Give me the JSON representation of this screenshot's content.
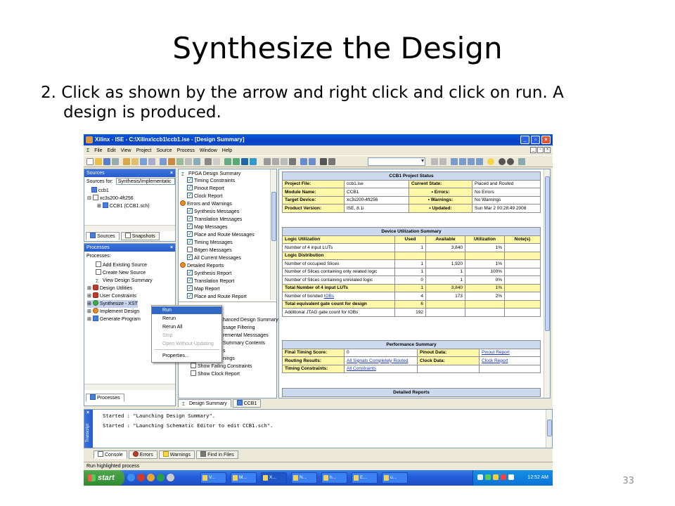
{
  "slide": {
    "title": "Synthesize the Design",
    "body_line1": "2. Click as shown by the arrow and right click and click on run.  A",
    "body_line2": "design is produced.",
    "page_number": "33"
  },
  "window": {
    "title": "Xilinx - ISE - C:\\Xilinx\\ccb1\\ccb1.ise - [Design Summary]",
    "menu": [
      "File",
      "Edit",
      "View",
      "Project",
      "Source",
      "Process",
      "Window",
      "Help"
    ]
  },
  "sources": {
    "header": "Sources",
    "sources_for_label": "Sources for:",
    "sources_for_value": "Synthesis/Implementatic",
    "tree": [
      "ccb1",
      "xc3s200-4ft256",
      "CCB1 (CCB1.sch)"
    ],
    "tabs": [
      "Sources",
      "Snapshots"
    ]
  },
  "processes": {
    "header": "Processes",
    "subheader": "Processes:",
    "items": [
      "Add Existing Source",
      "Create New Source",
      "View Design Summary",
      "Design Utilities",
      "User Constraints",
      "Synthesize - XST",
      "Implement Design",
      "Generate Program"
    ],
    "tab": "Processes"
  },
  "context_menu": {
    "items": [
      "Run",
      "Rerun",
      "Rerun All",
      "Stop",
      "Open Without Updating",
      "Properties..."
    ]
  },
  "summary_tree": {
    "header": "FPGA Design Summary",
    "items": [
      "Timing Constraints",
      "Pinout Report",
      "Clock Report",
      "Errors and Warnings",
      "Synthesis Messages",
      "Translation Messages",
      "Map Messages",
      "Place and Route Messages",
      "Timing Messages",
      "Bitgen Messages",
      "All Current Messages",
      "Detailed Reports",
      "Synthesis Report",
      "Translation Report",
      "Map Report",
      "Place and Route Report"
    ],
    "lower_items": [
      "hanced Design Summary",
      "ssage Filtering",
      "remental Messsages",
      "Summary Contents",
      "s",
      "nings",
      "Show Failing Constraints",
      "Show Clock Report"
    ],
    "tabs": [
      "Design Summary",
      "CCB1"
    ]
  },
  "project_status": {
    "title": "CCB1 Project Status",
    "rows": [
      [
        "Project File:",
        "ccb1.ise",
        "Current State:",
        "Placed and Routed"
      ],
      [
        "Module Name:",
        "CCB1",
        "• Errors:",
        "No Errors"
      ],
      [
        "Target Device:",
        "xc3s200-4ft256",
        "• Warnings:",
        "No Warnings"
      ],
      [
        "Product Version:",
        "ISE, 8.1i",
        "• Updated:",
        "Sun Mar 2 00:28:49 2008"
      ]
    ]
  },
  "utilization": {
    "title": "Device Utilization Summary",
    "columns": [
      "Logic Utilization",
      "Used",
      "Available",
      "Utilization",
      "Note(s)"
    ],
    "rows": [
      [
        "Number of 4 input LUTs",
        "1",
        "3,840",
        "1%",
        ""
      ],
      [
        "Logic Distribution",
        "",
        "",
        "",
        ""
      ],
      [
        "Number of occupied Slices",
        "1",
        "1,920",
        "1%",
        ""
      ],
      [
        "Number of Slices containing only related logic",
        "1",
        "1",
        "100%",
        ""
      ],
      [
        "Number of Slices containing unrelated logic",
        "0",
        "1",
        "0%",
        ""
      ],
      [
        "Total Number of 4 input LUTs",
        "1",
        "3,840",
        "1%",
        ""
      ],
      [
        "Number of bonded IOBs",
        "4",
        "173",
        "2%",
        ""
      ],
      [
        "Total equivalent gate count for design",
        "6",
        "",
        "",
        ""
      ],
      [
        "Additional JTAG gate count for IOBs",
        "192",
        "",
        "",
        ""
      ]
    ]
  },
  "performance": {
    "title": "Performance Summary",
    "rows": [
      [
        "Final Timing Score:",
        "0",
        "Pinout Data:",
        "Pinout Report"
      ],
      [
        "Routing Results:",
        "All Signals Completely Routed",
        "Clock Data:",
        "Clock Report"
      ],
      [
        "Timing Constraints:",
        "All Constraints",
        "",
        ""
      ]
    ]
  },
  "detailed_reports": {
    "title": "Detailed Reports"
  },
  "transcript": {
    "side_label": "Transcript",
    "lines": [
      "Started : \"Launching Design Summary\".",
      "Started : \"Launching Schematic Editor to edit CCB1.sch\"."
    ],
    "tabs": [
      "Console",
      "Errors",
      "Warnings",
      "Find in Files"
    ]
  },
  "status_bar": "Run highlighted process",
  "taskbar": {
    "start": "start",
    "tasks": [
      "V...",
      "M...",
      "X...",
      "N...",
      "h...",
      "E...",
      "u..."
    ],
    "clock": "12:52 AM"
  }
}
